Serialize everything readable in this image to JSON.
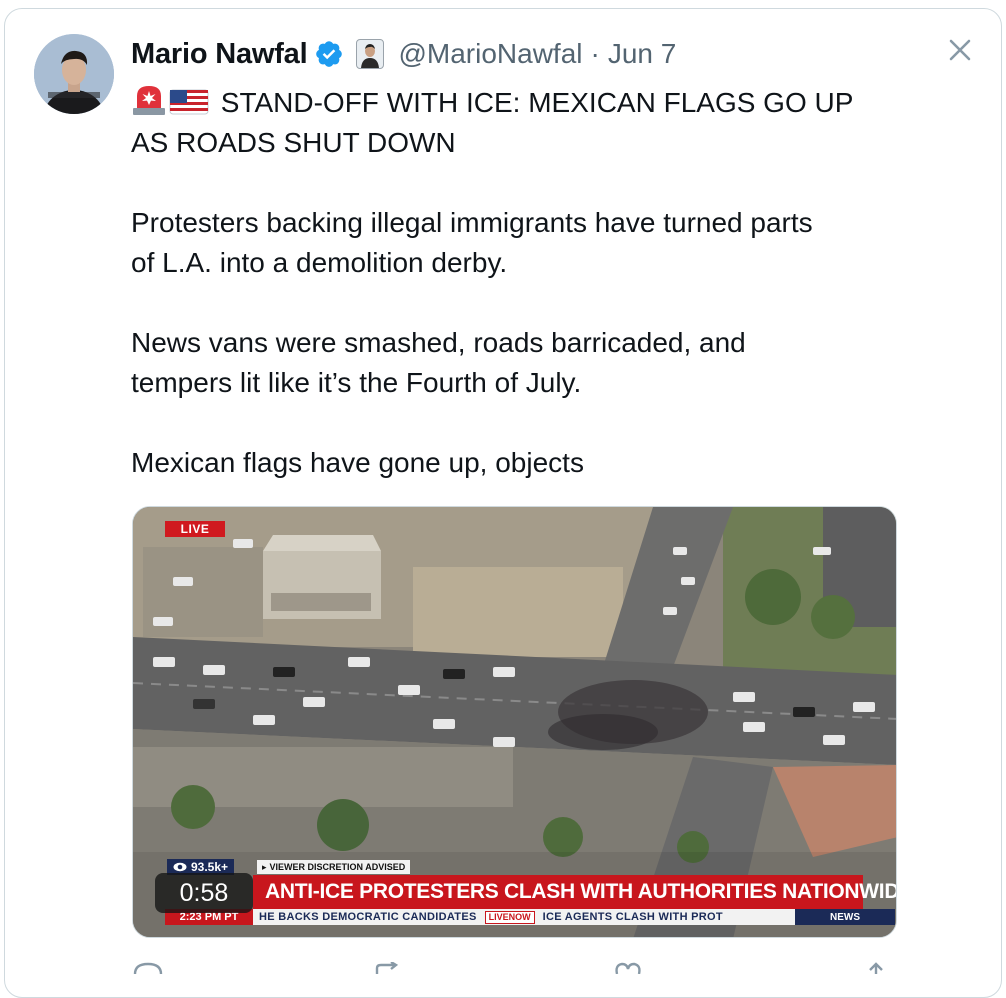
{
  "post": {
    "author_name": "Mario Nawfal",
    "handle": "@MarioNawfal",
    "separator": "·",
    "date": "Jun 7",
    "text_lines": [
      "STAND-OFF WITH ICE: MEXICAN FLAGS GO UP",
      "AS ROADS SHUT DOWN",
      "Protesters backing illegal immigrants have turned parts",
      "of L.A. into a demolition derby.",
      "News vans were smashed, roads barricaded, and",
      "tempers lit like it’s the Fourth of July.",
      "Mexican flags have gone up, objects"
    ],
    "leading_emojis": [
      "siren-emoji",
      "us-flag-emoji"
    ]
  },
  "video": {
    "live_label": "LIVE",
    "viewer_count": "93.5k+",
    "discretion_notice": "VIEWER DISCRETION ADVISED",
    "headline": "ANTI-ICE PROTESTERS CLASH WITH AUTHORITIES NATIONWIDE",
    "duration": "0:58",
    "ticker_time": "2:23 PM PT",
    "ticker_text_1": "HE BACKS DEMOCRATIC CANDIDATES",
    "ticker_badge": "LIVENOW",
    "ticker_text_2": "ICE AGENTS CLASH WITH PROT",
    "network_label": "NEWS"
  },
  "colors": {
    "verified_blue": "#1d9bf0",
    "text_primary": "#0f1419",
    "text_secondary": "#536471",
    "banner_red": "#c8161d",
    "banner_navy": "#1b2a57"
  },
  "icons": [
    "verified-badge-icon",
    "affiliate-badge-icon",
    "close-icon",
    "reply-icon",
    "repost-icon",
    "like-icon",
    "share-icon"
  ]
}
